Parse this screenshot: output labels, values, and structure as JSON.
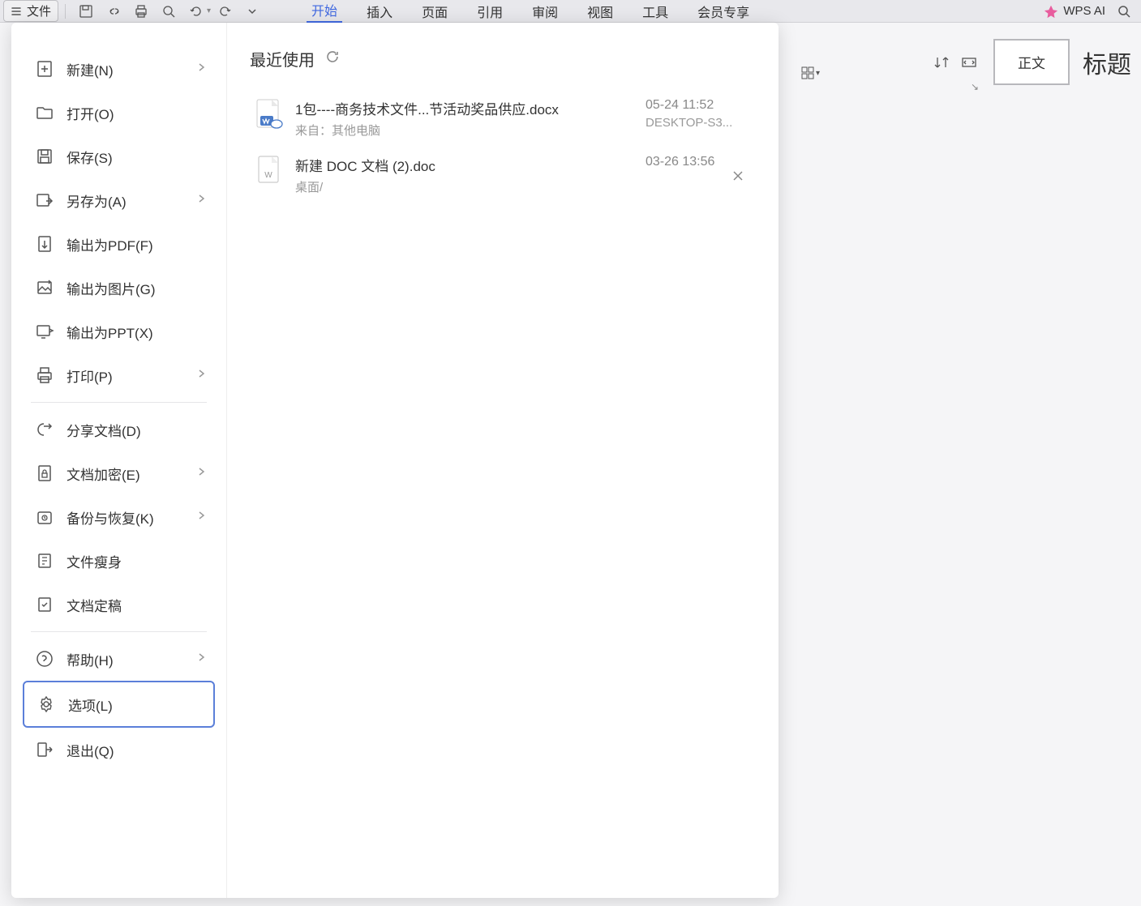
{
  "toolbar": {
    "file_label": "文件",
    "tabs": [
      "开始",
      "插入",
      "页面",
      "引用",
      "审阅",
      "视图",
      "工具",
      "会员专享"
    ],
    "wps_ai_label": "WPS AI"
  },
  "styles": {
    "normal": "正文",
    "heading": "标题"
  },
  "sidebar": {
    "items": [
      {
        "label": "新建(N)",
        "icon": "plus-doc",
        "has_chevron": true
      },
      {
        "label": "打开(O)",
        "icon": "folder-open",
        "has_chevron": false
      },
      {
        "label": "保存(S)",
        "icon": "save",
        "has_chevron": false
      },
      {
        "label": "另存为(A)",
        "icon": "save-as",
        "has_chevron": true
      },
      {
        "label": "输出为PDF(F)",
        "icon": "export-pdf",
        "has_chevron": false
      },
      {
        "label": "输出为图片(G)",
        "icon": "export-image",
        "has_chevron": false
      },
      {
        "label": "输出为PPT(X)",
        "icon": "export-ppt",
        "has_chevron": false
      },
      {
        "label": "打印(P)",
        "icon": "print",
        "has_chevron": true
      },
      {
        "label": "分享文档(D)",
        "icon": "share",
        "has_chevron": false
      },
      {
        "label": "文档加密(E)",
        "icon": "encrypt",
        "has_chevron": true
      },
      {
        "label": "备份与恢复(K)",
        "icon": "backup",
        "has_chevron": true
      },
      {
        "label": "文件瘦身",
        "icon": "compress",
        "has_chevron": false
      },
      {
        "label": "文档定稿",
        "icon": "finalize",
        "has_chevron": false
      },
      {
        "label": "帮助(H)",
        "icon": "help",
        "has_chevron": true
      },
      {
        "label": "选项(L)",
        "icon": "options",
        "has_chevron": false,
        "selected": true
      },
      {
        "label": "退出(Q)",
        "icon": "exit",
        "has_chevron": false
      }
    ]
  },
  "recent": {
    "title": "最近使用",
    "files": [
      {
        "name": "1包----商务技术文件...节活动奖品供应.docx",
        "source": "来自：其他电脑",
        "date": "05-24 11:52",
        "device": "DESKTOP-S3...",
        "icon": "docx-cloud"
      },
      {
        "name": "新建 DOC 文档 (2).doc",
        "source": "桌面/",
        "date": "03-26 13:56",
        "device": "",
        "icon": "doc",
        "show_close": true
      }
    ]
  }
}
